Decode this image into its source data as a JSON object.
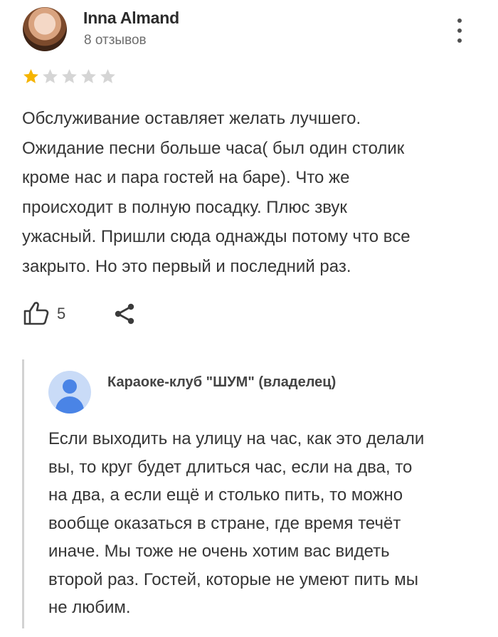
{
  "review": {
    "author": "Inna Almand",
    "reviews_count": "8 отзывов",
    "rating": 1,
    "rating_max": 5,
    "star_filled_color": "#f5b400",
    "star_empty_color": "#d5d5d5",
    "text": "Обслуживание оставляет желать лучшего.\nОжидание песни больше часа( был один столик\nкроме нас и пара гостей на баре). Что же\nпроисходит в полную посадку. Плюс звук\nужасный. Пришли сюда однажды потому что все\nзакрыто. Но это первый и последний раз.",
    "likes": "5"
  },
  "reply": {
    "owner_name": "Караоке-клуб \"ШУМ\" (владелец)",
    "text": "Если выходить на улицу на час, как это делали\nвы, то круг будет длиться час, если на два, то\nна два, а если ещё и столько пить, то можно\nвообще оказаться в стране, где время течёт\nиначе. Мы тоже не очень хотим вас видеть\nвторой раз. Гостей, которые не умеют пить мы\nне любим."
  },
  "icons": {
    "menu": "more-vertical-icon",
    "like": "thumbs-up-icon",
    "share": "share-icon",
    "avatar_placeholder": "person-icon",
    "accent": "#4a84e6"
  }
}
